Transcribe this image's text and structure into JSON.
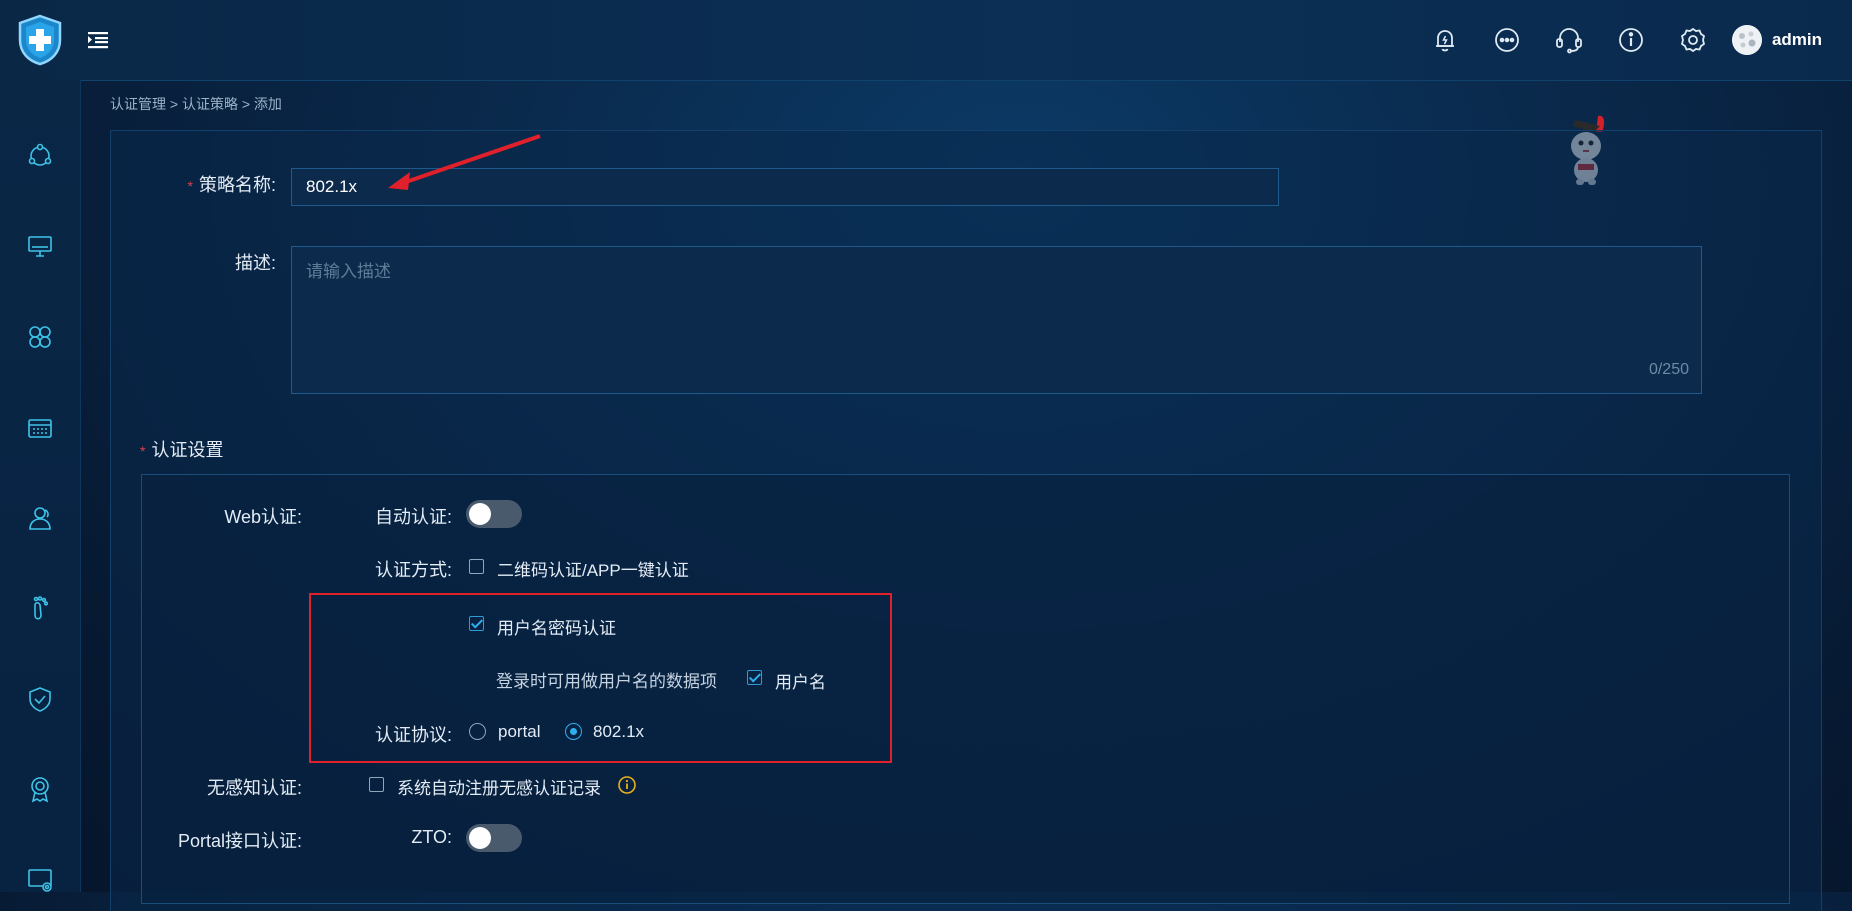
{
  "header": {
    "icons": [
      "bell-icon",
      "more-dots-icon",
      "headset-icon",
      "info-icon",
      "gear-icon"
    ],
    "user": {
      "name": "admin"
    }
  },
  "sidebar": {
    "items": [
      "network-topology-icon",
      "monitor-icon",
      "apps-icon",
      "terminal-device-icon",
      "users-icon",
      "footprint-icon",
      "shield-check-icon",
      "certificate-icon",
      "screen-settings-icon"
    ]
  },
  "breadcrumb": "认证管理 > 认证策略 > 添加",
  "form": {
    "policy_name_label": "策略名称:",
    "policy_name_value": "802.1x",
    "description_label": "描述:",
    "description_placeholder": "请输入描述",
    "description_counter": "0/250",
    "auth_settings_label": "认证设置",
    "web_auth_label": "Web认证:",
    "auto_auth_label": "自动认证:",
    "auto_auth_enabled": false,
    "auth_method_label": "认证方式:",
    "qr_app_option": "二维码认证/APP一键认证",
    "qr_app_checked": false,
    "username_pwd_option": "用户名密码认证",
    "username_pwd_checked": true,
    "login_fields_label": "登录时可用做用户名的数据项",
    "username_field_option": "用户名",
    "username_field_checked": true,
    "auth_protocol_label": "认证协议:",
    "protocol_portal": "portal",
    "protocol_8021x": "802.1x",
    "protocol_selected": "802.1x",
    "seamless_auth_label": "无感知认证:",
    "seamless_option": "系统自动注册无感认证记录",
    "seamless_checked": false,
    "portal_api_label": "Portal接口认证:",
    "zto_label": "ZTO:",
    "zto_enabled": false
  },
  "colors": {
    "accent": "#2fb0ee",
    "required": "#e0404a",
    "highlight_box": "#e0202a",
    "info_icon": "#e8b21a"
  }
}
